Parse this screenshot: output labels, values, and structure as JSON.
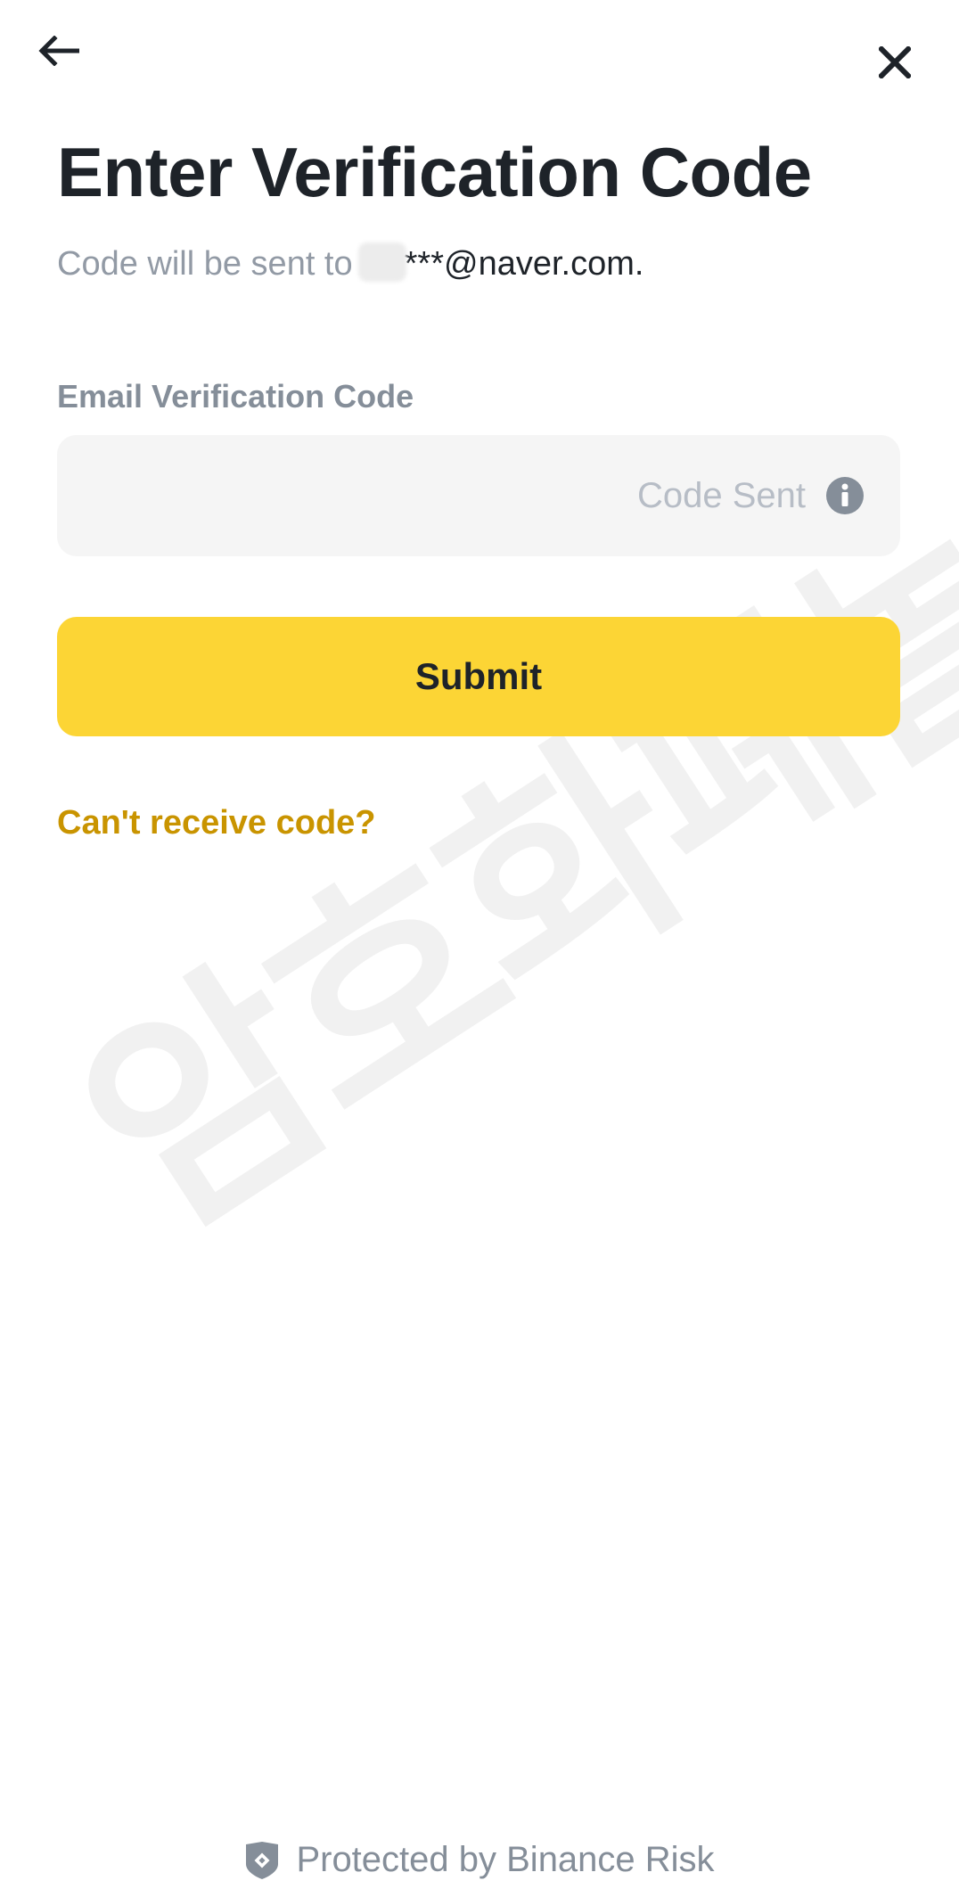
{
  "header": {
    "back_icon": "arrow-left-icon",
    "close_icon": "close-icon"
  },
  "title": "Enter Verification Code",
  "subtitle": {
    "prefix": "Code will be sent to",
    "email": "***@naver.com."
  },
  "email_field": {
    "label": "Email Verification Code",
    "value": "",
    "status": "Code Sent",
    "info_icon": "info-icon"
  },
  "submit": {
    "label": "Submit",
    "color": "#fcd535"
  },
  "help_link": {
    "label": "Can't receive code?",
    "color": "#c99400"
  },
  "footer": {
    "icon": "shield-icon",
    "text": "Protected by Binance Risk"
  },
  "watermark": {
    "text": "암호화폐놀이터"
  },
  "colors": {
    "text_primary": "#1e2329",
    "text_secondary": "#929aa5",
    "input_bg": "#f5f5f5",
    "accent": "#fcd535",
    "link": "#c99400"
  }
}
